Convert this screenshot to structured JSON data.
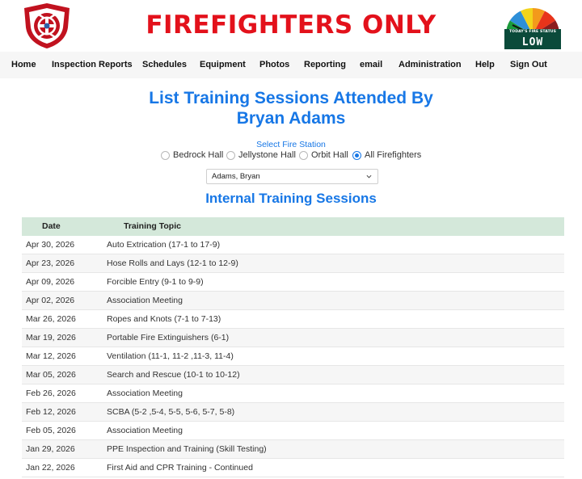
{
  "header": {
    "title": "FIREFIGHTERS ONLY",
    "fire_status_caption": "TODAY'S FIRE STATUS",
    "fire_status_level": "LOW",
    "brand_red": "#e3111b",
    "accent_blue": "#1777e6"
  },
  "nav": {
    "items": [
      {
        "label": "Home"
      },
      {
        "label": "Inspection Reports"
      },
      {
        "label": "Schedules"
      },
      {
        "label": "Equipment"
      },
      {
        "label": "Photos"
      },
      {
        "label": "Reporting"
      },
      {
        "label": "email"
      },
      {
        "label": "Administration"
      },
      {
        "label": "Help"
      },
      {
        "label": "Sign Out"
      }
    ]
  },
  "page": {
    "title_line1": "List Training Sessions Attended By",
    "title_line2": "Bryan Adams"
  },
  "station": {
    "label": "Select Fire Station",
    "options": [
      {
        "label": "Bedrock Hall",
        "checked": false
      },
      {
        "label": "Jellystone Hall",
        "checked": false
      },
      {
        "label": "Orbit Hall",
        "checked": false
      },
      {
        "label": "All Firefighters",
        "checked": true
      }
    ]
  },
  "firefighter_select": {
    "selected": "Adams, Bryan"
  },
  "sessions": {
    "title": "Internal Training Sessions",
    "columns": {
      "date": "Date",
      "topic": "Training Topic"
    },
    "rows": [
      {
        "date": "Apr 30, 2026",
        "topic": "Auto Extrication (17-1 to 17-9)"
      },
      {
        "date": "Apr 23, 2026",
        "topic": "Hose Rolls and Lays (12-1 to 12-9)"
      },
      {
        "date": "Apr 09, 2026",
        "topic": "Forcible Entry (9-1 to 9-9)"
      },
      {
        "date": "Apr 02, 2026",
        "topic": "Association Meeting"
      },
      {
        "date": "Mar 26, 2026",
        "topic": "Ropes and Knots (7-1 to 7-13)"
      },
      {
        "date": "Mar 19, 2026",
        "topic": "Portable Fire Extinguishers (6-1)"
      },
      {
        "date": "Mar 12, 2026",
        "topic": "Ventilation (11-1, 11-2 ,11-3, 11-4)"
      },
      {
        "date": "Mar 05, 2026",
        "topic": "Search and Rescue (10-1 to 10-12)"
      },
      {
        "date": "Feb 26, 2026",
        "topic": "Association Meeting"
      },
      {
        "date": "Feb 12, 2026",
        "topic": "SCBA (5-2 ,5-4, 5-5, 5-6, 5-7, 5-8)"
      },
      {
        "date": "Feb 05, 2026",
        "topic": "Association Meeting"
      },
      {
        "date": "Jan 29, 2026",
        "topic": "PPE Inspection and Training (Skill Testing)"
      },
      {
        "date": "Jan 22, 2026",
        "topic": "First Aid and CPR Training - Continued"
      }
    ]
  }
}
